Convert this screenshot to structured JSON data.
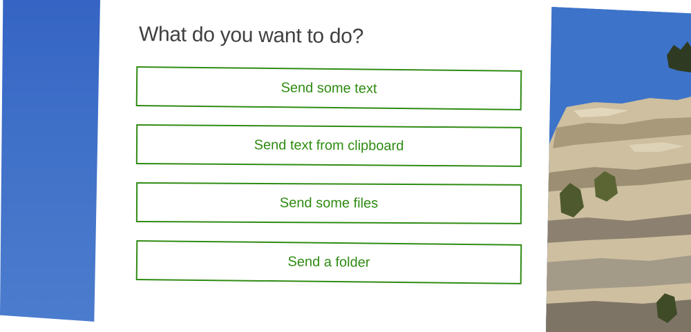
{
  "dialog": {
    "title": "What do you want to do?",
    "options": [
      {
        "label": "Send some text"
      },
      {
        "label": "Send text from clipboard"
      },
      {
        "label": "Send some files"
      },
      {
        "label": "Send a folder"
      }
    ]
  },
  "colors": {
    "accent": "#2e8b11",
    "title_text": "#404040",
    "sky": "#3d73c9"
  }
}
